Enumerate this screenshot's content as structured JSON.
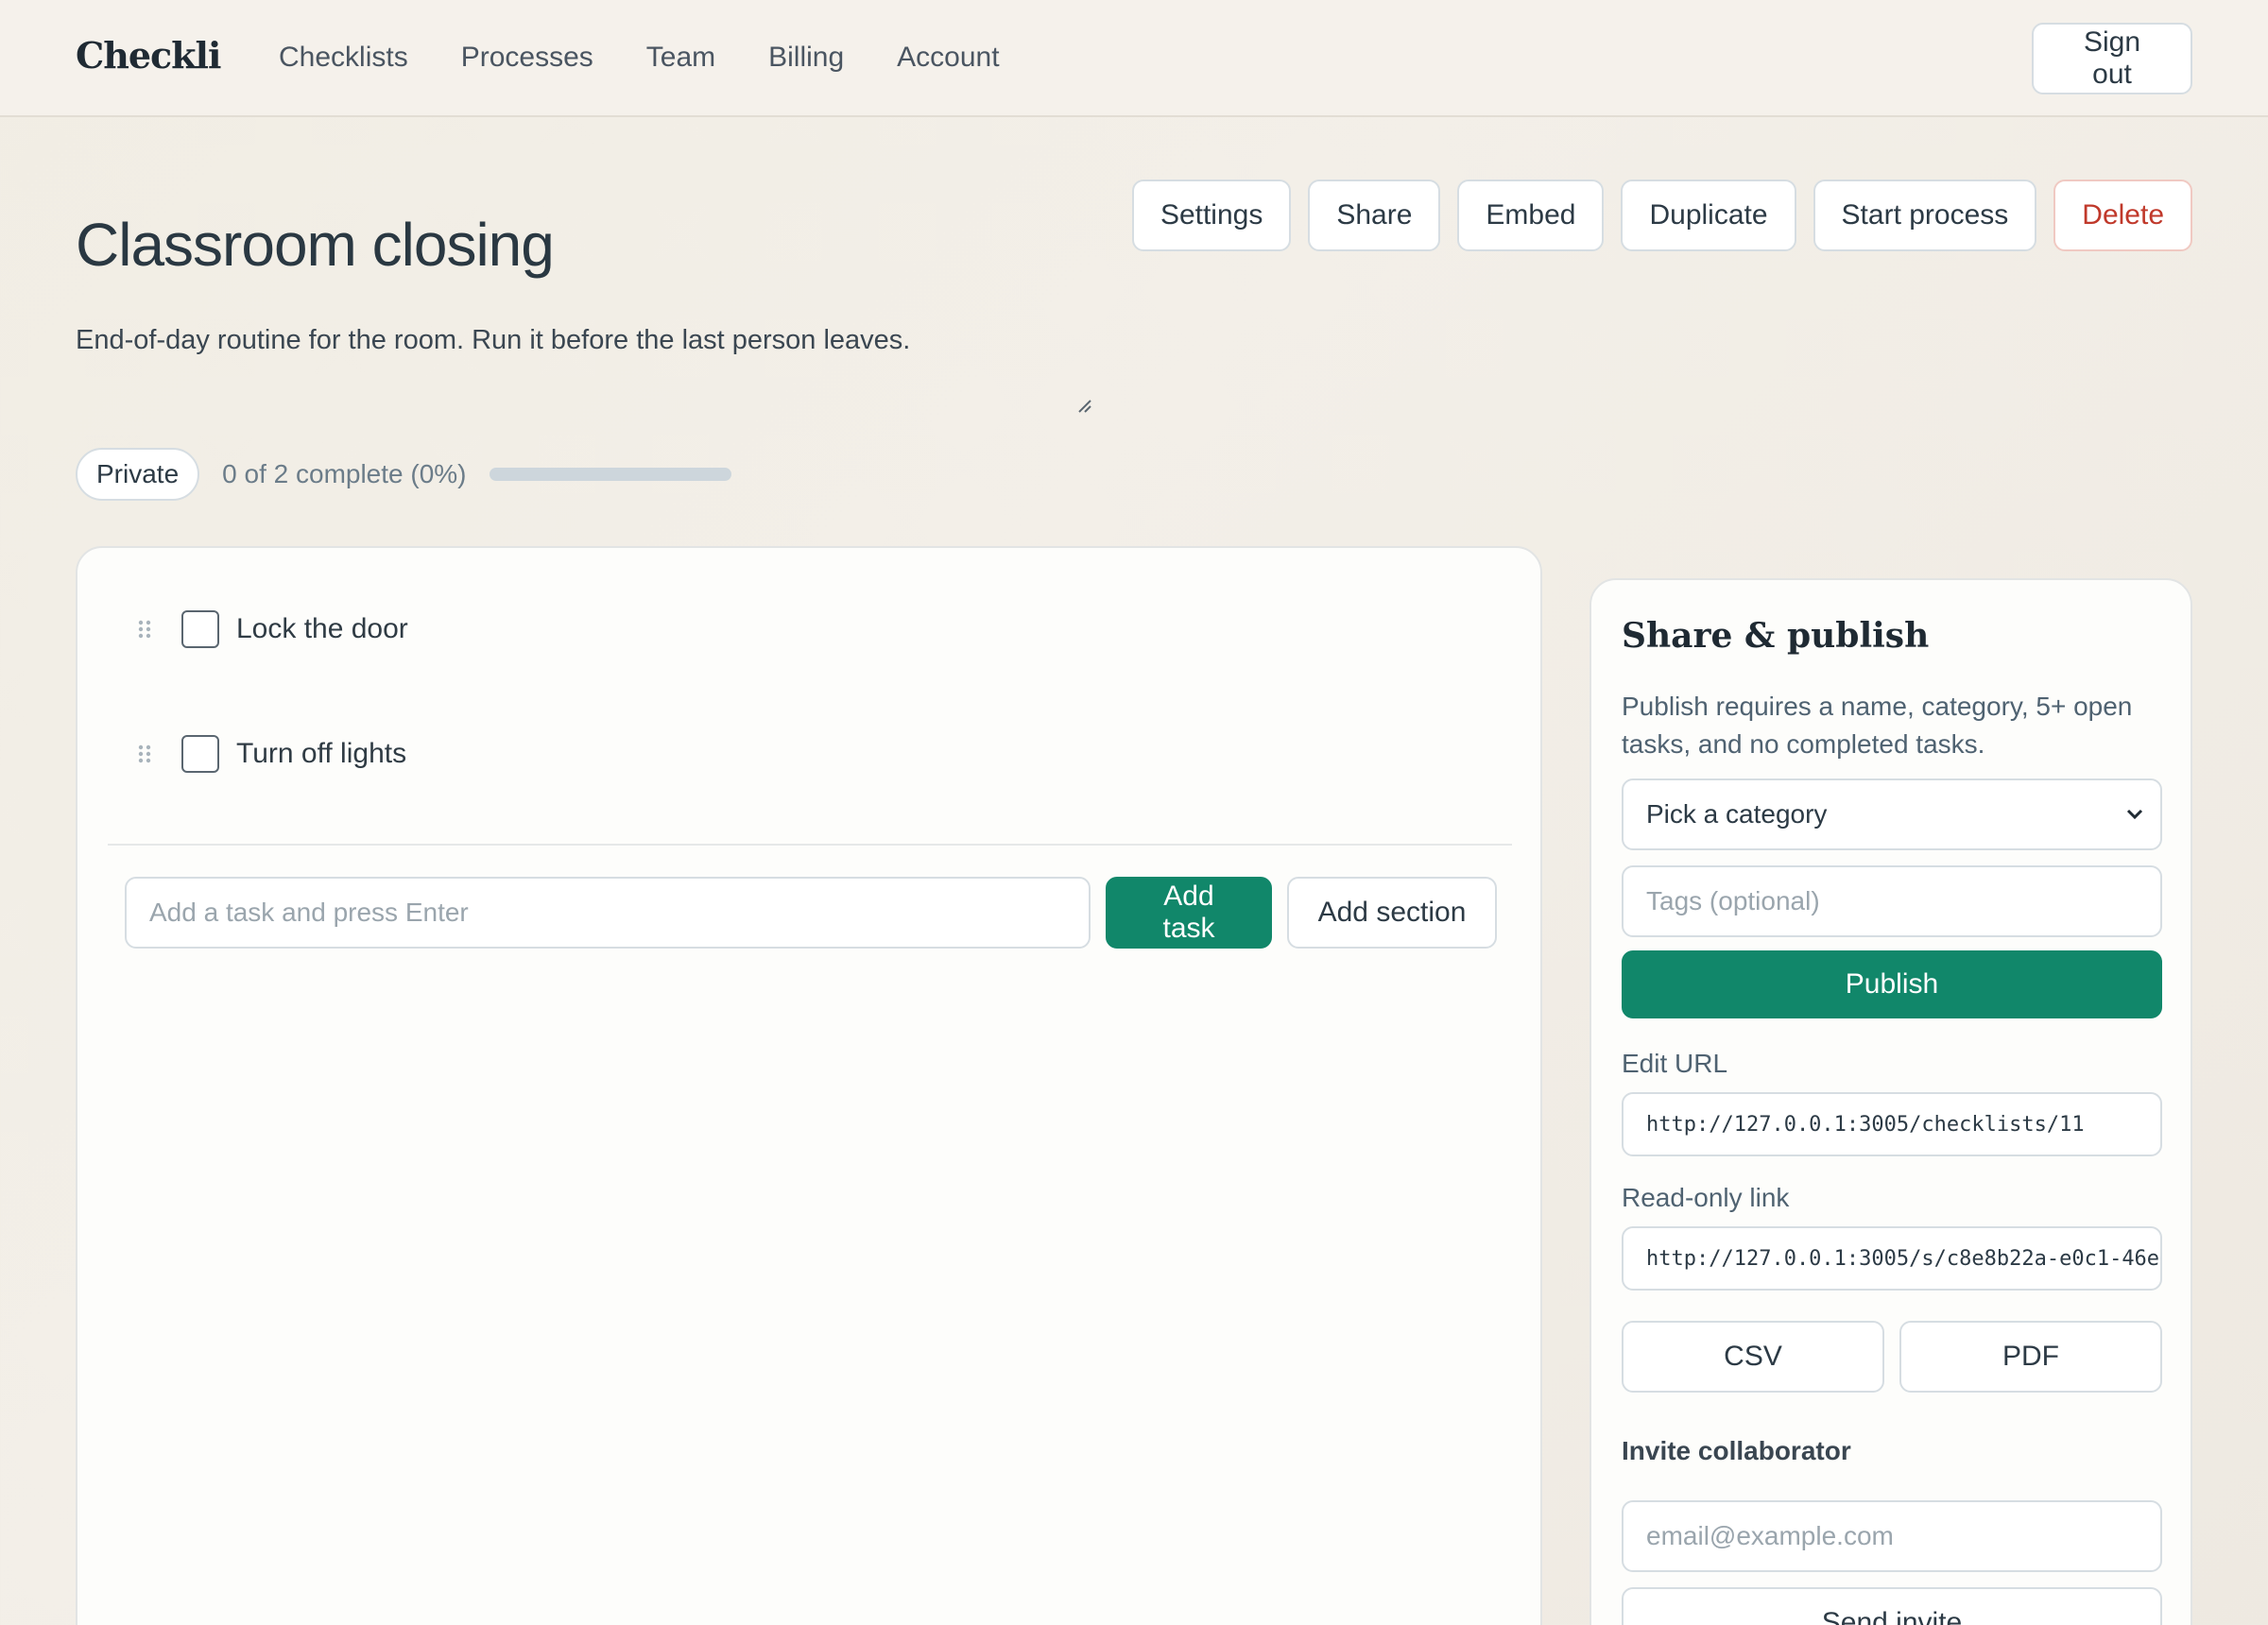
{
  "nav": {
    "brand": "Checkli",
    "links": [
      "Checklists",
      "Processes",
      "Team",
      "Billing",
      "Account"
    ],
    "sign_out": "Sign out"
  },
  "header": {
    "title": "Classroom closing",
    "description": "End-of-day routine for the room. Run it before the last person leaves.",
    "actions": {
      "settings": "Settings",
      "share": "Share",
      "embed": "Embed",
      "duplicate": "Duplicate",
      "start_process": "Start process",
      "delete": "Delete"
    },
    "visibility": "Private",
    "progress_text": "0 of 2 complete (0%)",
    "progress_fraction": 0
  },
  "tasks": [
    {
      "label": "Lock the door",
      "checked": false
    },
    {
      "label": "Turn off lights",
      "checked": false
    }
  ],
  "composer": {
    "placeholder": "Add a task and press Enter",
    "add_task": "Add task",
    "add_section": "Add section"
  },
  "share": {
    "title": "Share & publish",
    "note": "Publish requires a name, category, 5+ open tasks, and no completed tasks.",
    "category_selected": "Pick a category",
    "tags_placeholder": "Tags (optional)",
    "publish": "Publish",
    "edit_url_label": "Edit URL",
    "edit_url": "http://127.0.0.1:3005/checklists/11",
    "readonly_label": "Read-only link",
    "readonly_url": "http://127.0.0.1:3005/s/c8e8b22a-e0c1-46e",
    "csv": "CSV",
    "pdf": "PDF",
    "invite_label": "Invite collaborator",
    "invite_placeholder": "email@example.com",
    "send_invite": "Send invite"
  },
  "colors": {
    "primary": "#11876a",
    "danger": "#c0392b",
    "background": "#f2eee7"
  }
}
